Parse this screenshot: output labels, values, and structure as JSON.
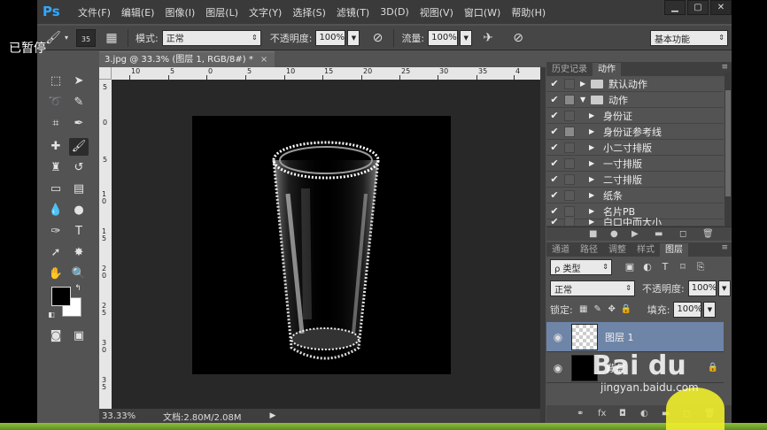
{
  "overlay": {
    "paused": "已暂停"
  },
  "menubar": {
    "logo": "Ps",
    "items": [
      "文件(F)",
      "编辑(E)",
      "图像(I)",
      "图层(L)",
      "文字(Y)",
      "选择(S)",
      "滤镜(T)",
      "3D(D)",
      "视图(V)",
      "窗口(W)",
      "帮助(H)"
    ],
    "minimize": "▁",
    "maximize": "▢",
    "close": "✕"
  },
  "options": {
    "brush_size": "35",
    "mode_label": "模式:",
    "mode_value": "正常",
    "opacity_label": "不透明度:",
    "opacity_value": "100%",
    "flow_label": "流量:",
    "flow_value": "100%",
    "workspace": "基本功能"
  },
  "document": {
    "tab_title": "3.jpg @ 33.3% (图层 1, RGB/8#) *",
    "zoom": "33.33%",
    "doc_info": "文档:2.80M/2.08M",
    "ruler_h_labels": [
      "10",
      "5",
      "0",
      "5",
      "10",
      "15",
      "20",
      "25",
      "30",
      "35",
      "4"
    ],
    "ruler_v_labels": [
      "5",
      "0",
      "5",
      "1 0",
      "1 5",
      "2 0",
      "2 5",
      "3 0",
      "3 5"
    ]
  },
  "actions_panel": {
    "tabs": [
      "历史记录",
      "动作"
    ],
    "rows": [
      {
        "check": "✔",
        "type": "set",
        "label": "默认动作"
      },
      {
        "check": "✔",
        "type": "set-open",
        "label": "动作"
      },
      {
        "check": "✔",
        "type": "action",
        "label": "身份证"
      },
      {
        "check": "✔",
        "type": "action",
        "label": "身份证参考线"
      },
      {
        "check": "✔",
        "type": "action",
        "label": "小二寸排版"
      },
      {
        "check": "✔",
        "type": "action",
        "label": "一寸排版"
      },
      {
        "check": "✔",
        "type": "action",
        "label": "二寸排版"
      },
      {
        "check": "✔",
        "type": "action",
        "label": "纸条"
      },
      {
        "check": "✔",
        "type": "action",
        "label": "名片PB"
      },
      {
        "check": "✔",
        "type": "action",
        "label": "白口中而大小"
      }
    ]
  },
  "layers_panel": {
    "tabs": [
      "通道",
      "路径",
      "调整",
      "样式",
      "图层"
    ],
    "filter_kind": "ρ 类型",
    "blend_mode": "正常",
    "opacity_label": "不透明度:",
    "opacity_value": "100%",
    "lock_label": "锁定:",
    "fill_label": "填充:",
    "fill_value": "100%",
    "layers": [
      {
        "name": "图层 1",
        "selected": true
      },
      {
        "name": "背景",
        "selected": false
      }
    ]
  },
  "watermark": {
    "brand": "Bai du",
    "sub": "jingyan.baidu.com"
  },
  "colors": {
    "accent": "#31a8ff",
    "selection": "#6e85a8",
    "panel": "#535353"
  }
}
